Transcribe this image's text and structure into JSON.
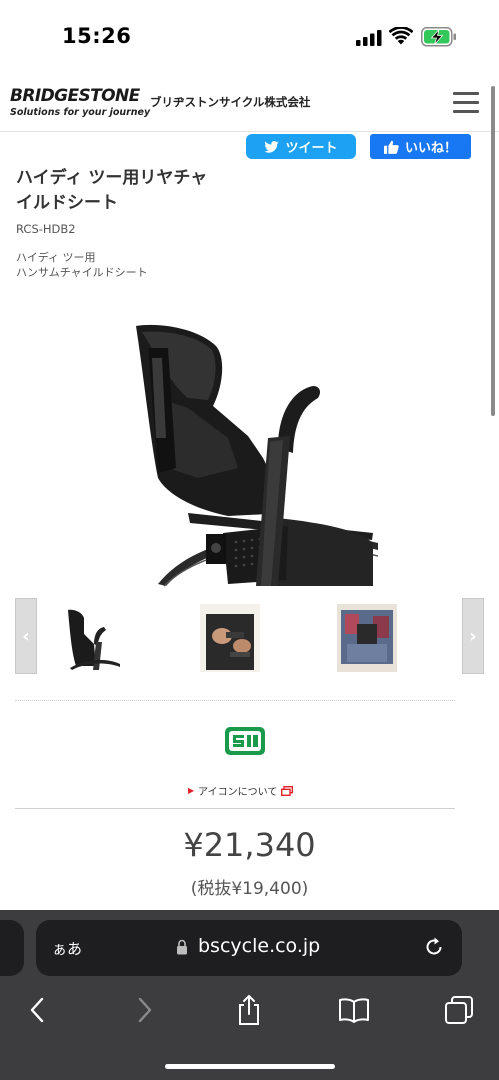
{
  "status": {
    "time": "15:26"
  },
  "header": {
    "brand": "BRIDGESTONE",
    "tagline": "Solutions for your journey",
    "company": "ブリヂストンサイクル株式会社"
  },
  "share": {
    "tweet_label": "ツイート",
    "like_label": "いいね！"
  },
  "product": {
    "title_line1": "ハイディ ツー用リヤチャ",
    "title_line2": "イルドシート",
    "code": "RCS-HDB2",
    "subtitle_line1": "ハイディ ツー用",
    "subtitle_line2": "ハンサムチャイルドシート"
  },
  "gallery": {
    "prev_label": "‹",
    "next_label": "›"
  },
  "icons_section": {
    "link_label": "アイコンについて"
  },
  "price": {
    "main": "¥21,340",
    "excl_tax": "(税抜¥19,400)"
  },
  "browser": {
    "aa_label": "ぁあ",
    "url": "bscycle.co.jp"
  },
  "colors": {
    "twitter": "#1da1f2",
    "facebook": "#1877f2",
    "accent_red": "#e0242a",
    "badge_green": "#1a9b4b"
  }
}
